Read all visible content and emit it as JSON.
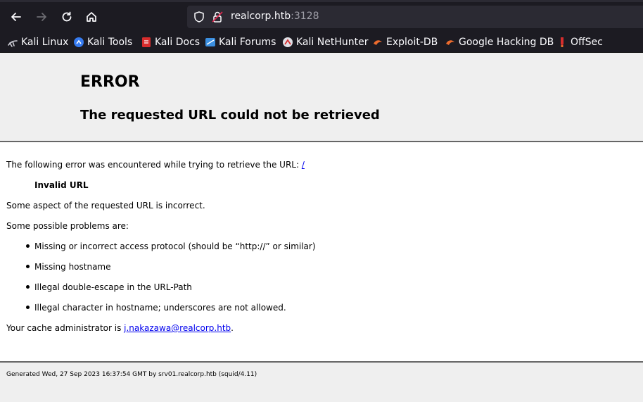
{
  "browser": {
    "url_host": "realcorp.htb",
    "url_port": ":3128"
  },
  "bookmarks": [
    {
      "label": "Kali Linux",
      "icon": "kali-dragon-icon"
    },
    {
      "label": "Kali Tools",
      "icon": "kali-tools-icon"
    },
    {
      "label": "Kali Docs",
      "icon": "kali-docs-icon"
    },
    {
      "label": "Kali Forums",
      "icon": "kali-forums-icon"
    },
    {
      "label": "Kali NetHunter",
      "icon": "nethunter-icon"
    },
    {
      "label": "Exploit-DB",
      "icon": "exploit-db-icon"
    },
    {
      "label": "Google Hacking DB",
      "icon": "ghdb-icon"
    },
    {
      "label": "OffSec",
      "icon": "offsec-icon"
    }
  ],
  "error": {
    "title": "ERROR",
    "subtitle": "The requested URL could not be retrieved",
    "intro": "The following error was encountered while trying to retrieve the URL: ",
    "url_link": "/",
    "error_name": "Invalid URL",
    "description": "Some aspect of the requested URL is incorrect.",
    "problems_heading": "Some possible problems are:",
    "problems": [
      "Missing or incorrect access protocol (should be “http://” or similar)",
      "Missing hostname",
      "Illegal double-escape in the URL-Path",
      "Illegal character in hostname; underscores are not allowed."
    ],
    "admin_prefix": "Your cache administrator is ",
    "admin_email": "j.nakazawa@realcorp.htb",
    "admin_suffix": "."
  },
  "footer": {
    "generated": "Generated Wed, 27 Sep 2023 16:37:54 GMT by srv01.realcorp.htb (squid/4.11)"
  }
}
